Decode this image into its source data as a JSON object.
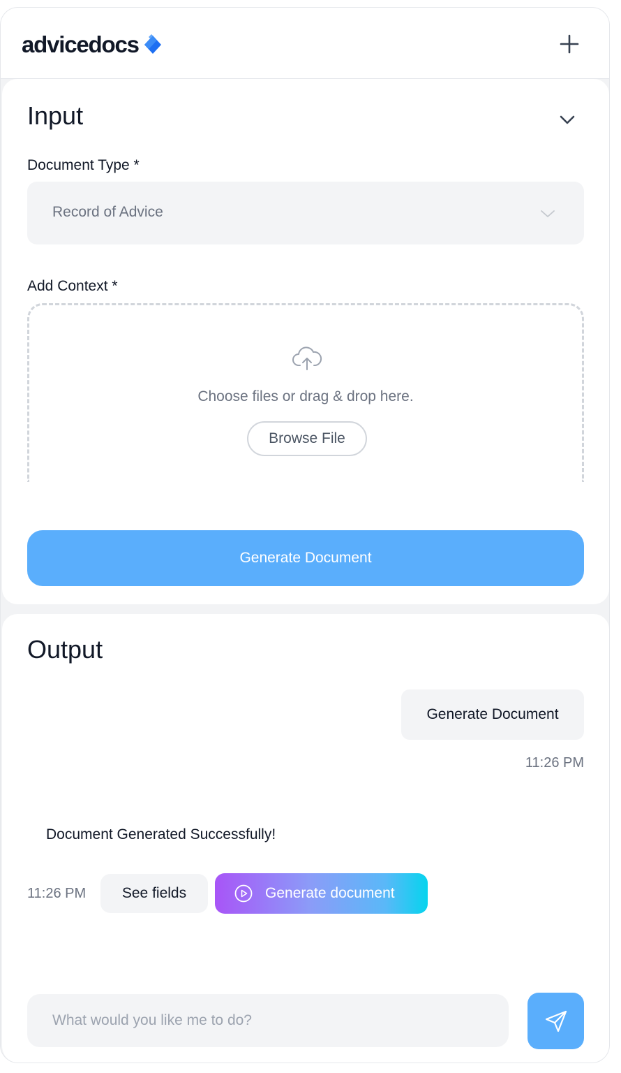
{
  "header": {
    "logo_text": "advicedocs",
    "new_icon": "plus-icon"
  },
  "input": {
    "title": "Input",
    "collapse_icon": "chevron-down-icon",
    "document_type": {
      "label": "Document Type *",
      "selected": "Record of Advice"
    },
    "context": {
      "label": "Add Context *",
      "drop_text": "Choose files or drag & drop here.",
      "browse_label": "Browse File",
      "upload_icon": "cloud-upload-icon"
    },
    "generate_label": "Generate Document"
  },
  "output": {
    "title": "Output",
    "user_message": "Generate Document",
    "user_time": "11:26 PM",
    "bot_message": "Document Generated Successfully!",
    "bot_time": "11:26 PM",
    "see_fields_label": "See fields",
    "generate_document_label": "Generate document",
    "generate_document_icon": "play-circle-icon"
  },
  "composer": {
    "placeholder": "What would you like me to do?",
    "value": "",
    "send_icon": "send-icon"
  },
  "colors": {
    "accent": "#5aaefc",
    "gradient_start": "#a855f7",
    "gradient_end": "#06d4ee",
    "logo_mark": "#1d6ff2"
  }
}
